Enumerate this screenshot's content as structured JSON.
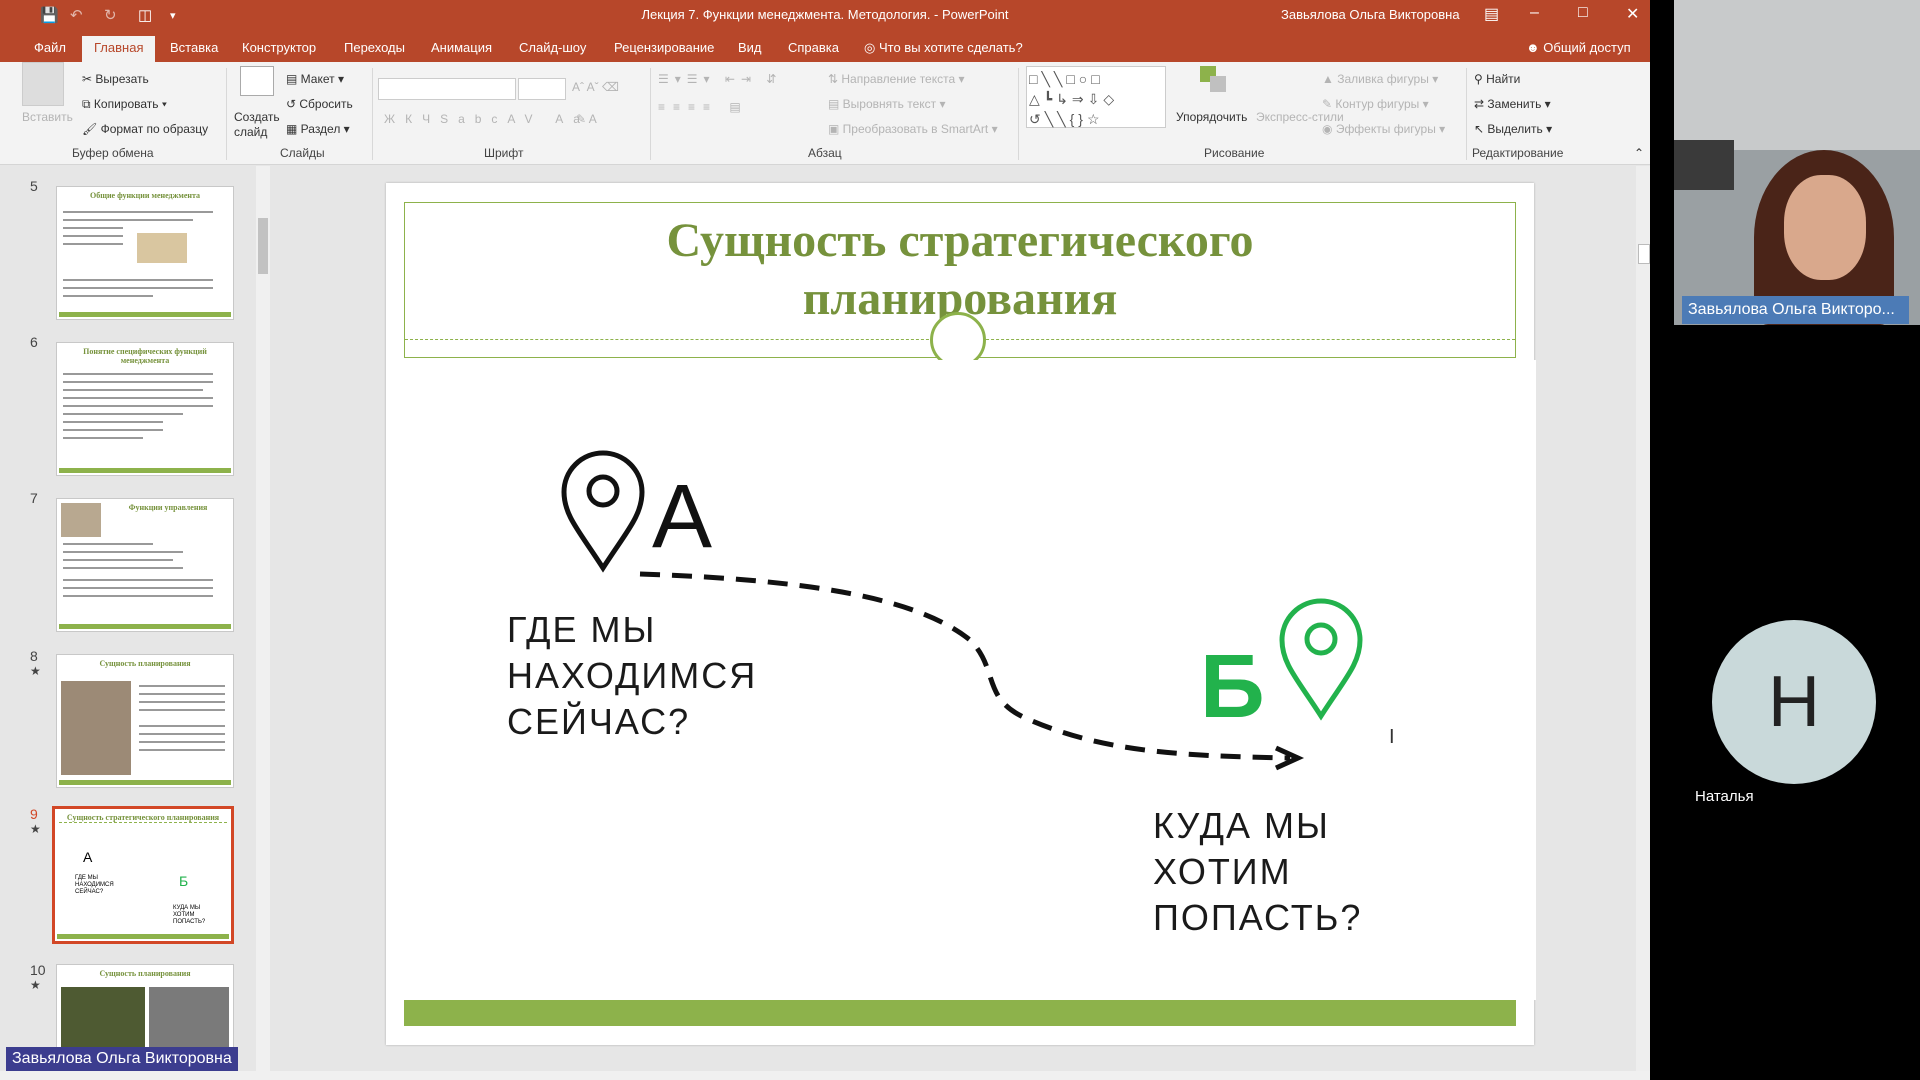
{
  "window": {
    "title": "Лекция 7. Функции менеджмента. Методология.  -  PowerPoint",
    "user": "Завьялова Ольга Викторовна",
    "titlebar_color": "#b7472a"
  },
  "menu": {
    "tabs": [
      "Файл",
      "Главная",
      "Вставка",
      "Конструктор",
      "Переходы",
      "Анимация",
      "Слайд-шоу",
      "Рецензирование",
      "Вид",
      "Справка"
    ],
    "tellme": "Что вы хотите сделать?",
    "share": "Общий доступ"
  },
  "ribbon": {
    "clipboard": {
      "paste": "Вставить",
      "cut": "Вырезать",
      "copy": "Копировать",
      "format_painter": "Формат по образцу",
      "label": "Буфер обмена"
    },
    "slides": {
      "new_slide": "Создать слайд",
      "layout": "Макет",
      "reset": "Сбросить",
      "section": "Раздел",
      "label": "Слайды"
    },
    "font": {
      "label": "Шрифт"
    },
    "paragraph": {
      "text_direction": "Направление текста",
      "align_text": "Выровнять текст",
      "smartart": "Преобразовать в SmartArt",
      "label": "Абзац"
    },
    "drawing": {
      "arrange": "Упорядочить",
      "quick_styles": "Экспресс-стили",
      "shape_fill": "Заливка фигуры",
      "shape_outline": "Контур фигуры",
      "shape_effects": "Эффекты фигуры",
      "label": "Рисование"
    },
    "editing": {
      "find": "Найти",
      "replace": "Заменить",
      "select": "Выделить",
      "label": "Редактирование"
    }
  },
  "thumbnails": [
    {
      "num": "5",
      "title": "Общие функции менеджмента",
      "star": false
    },
    {
      "num": "6",
      "title": "Понятие специфических функций менеджмента",
      "star": false
    },
    {
      "num": "7",
      "title": "Функции управления",
      "star": false
    },
    {
      "num": "8",
      "title": "Сущность планирования",
      "star": true
    },
    {
      "num": "9",
      "title": "Сущность стратегического планирования",
      "star": true,
      "selected": true,
      "mini_a": "А",
      "mini_b": "Б",
      "mini_q1": "ГДЕ МЫ НАХОДИМСЯ СЕЙЧАС?",
      "mini_q2": "КУДА МЫ ХОТИМ ПОПАСТЬ?"
    },
    {
      "num": "10",
      "title": "Сущность планирования",
      "star": true
    }
  ],
  "slide": {
    "title_line1": "Сущность стратегического",
    "title_line2": "планирования",
    "point_a": "А",
    "point_b": "Б",
    "question_a": [
      "ГДЕ МЫ",
      "НАХОДИМСЯ",
      "СЕЙЧАС?"
    ],
    "question_b": [
      "КУДА МЫ",
      "ХОТИМ",
      "ПОПАСТЬ?"
    ],
    "accent_color": "#8db24b",
    "b_color": "#22b24c"
  },
  "participants": {
    "presenter_label": "Завьялова Ольга Викторо...",
    "attendee_initial": "Н",
    "attendee_name": "Наталья",
    "active_speaker": "Завьялова Ольга Викторовна"
  },
  "icons": [
    "save-icon",
    "undo-icon",
    "redo-icon",
    "start-icon",
    "customize-icon",
    "ribbon-display-icon",
    "minimize-icon",
    "maximize-icon",
    "close-icon",
    "lightbulb-icon",
    "person-icon",
    "scissors-icon",
    "copy-icon",
    "brush-icon",
    "search-icon",
    "replace-icon",
    "cursor-icon",
    "location-pin-icon",
    "arrow-icon"
  ]
}
